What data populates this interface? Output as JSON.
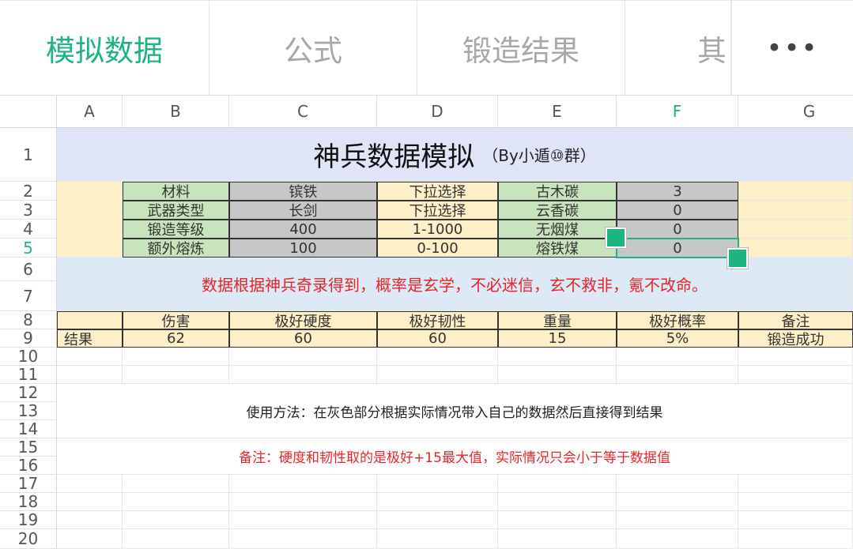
{
  "tabs": [
    {
      "label": "模拟数据"
    },
    {
      "label": "公式"
    },
    {
      "label": "锻造结果"
    },
    {
      "label": "其"
    }
  ],
  "more_label": "•••",
  "columns": [
    "A",
    "B",
    "C",
    "D",
    "E",
    "F",
    "G"
  ],
  "rows": [
    "1",
    "2",
    "3",
    "4",
    "5",
    "6",
    "7",
    "8",
    "9",
    "10",
    "11",
    "12",
    "13",
    "14",
    "15",
    "16",
    "17",
    "18",
    "19",
    "20"
  ],
  "sheet": {
    "title": "神兵数据模拟",
    "title_sub": "（By小遁⑩群）",
    "inputs": [
      {
        "label": "材料",
        "value": "镔铁",
        "hint": "下拉选择",
        "item": "古木碳",
        "qty": "3"
      },
      {
        "label": "武器类型",
        "value": "长剑",
        "hint": "下拉选择",
        "item": "云香碳",
        "qty": "0"
      },
      {
        "label": "锻造等级",
        "value": "400",
        "hint": "1-1000",
        "item": "无烟煤",
        "qty": "0"
      },
      {
        "label": "额外熔炼",
        "value": "100",
        "hint": "0-100",
        "item": "熔铁煤",
        "qty": "0"
      }
    ],
    "note_red": "数据根据神兵奇录得到，概率是玄学，不必迷信，玄不救非，氪不改命。",
    "result_headers": [
      "伤害",
      "极好硬度",
      "极好韧性",
      "重量",
      "极好概率",
      "备注"
    ],
    "result_label": "结果",
    "result_values": [
      "62",
      "60",
      "60",
      "15",
      "5%",
      "锻造成功"
    ],
    "usage": "使用方法：在灰色部分根据实际情况带入自己的数据然后直接得到结果",
    "remark": "备注：硬度和韧性取的是极好+15最大值，实际情况只会小于等于数据值"
  }
}
